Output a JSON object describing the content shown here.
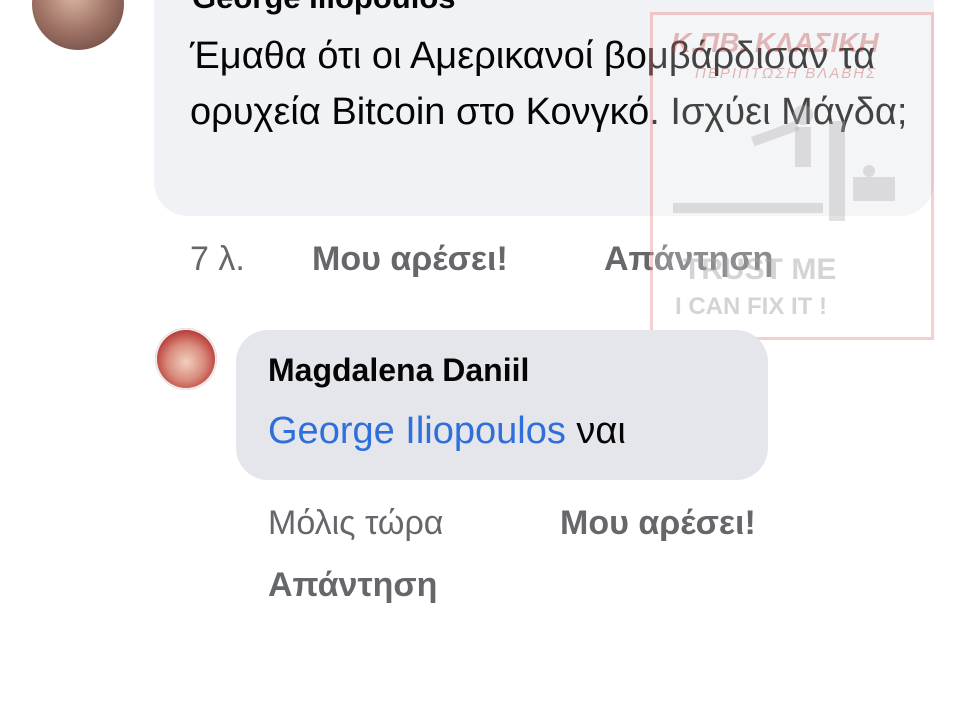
{
  "comment": {
    "author": "George Iliopoulos",
    "text": "Έμαθα ότι οι Αμερικανοί βομβάρδισαν τα ορυχεία Bitcoin στο Κονγκό. Ισχύει Μάγδα;",
    "time": "7 λ.",
    "like_label": "Μου αρέσει!",
    "reply_label": "Απάντηση"
  },
  "reply": {
    "author": "Magdalena Daniil",
    "mention": "George Iliopoulos",
    "text": "ναι",
    "time": "Μόλις τώρα",
    "like_label": "Μου αρέσει!",
    "reply_label": "Απάντηση"
  },
  "watermark": {
    "title": "Κ.ΠΒ. ΚΛΑΣΙΚΗ",
    "subtitle": "ΠΕΡΙΠΤΩΣΗ ΒΛΑΒΗΣ",
    "line1": "TRUST ME",
    "line2": "I CAN FIX IT !"
  },
  "colors": {
    "bubble": "#f0f2f5",
    "reply_bubble": "#e4e6eb",
    "mention": "#2e6fdc",
    "meta_text": "#65676b",
    "text": "#050505"
  }
}
